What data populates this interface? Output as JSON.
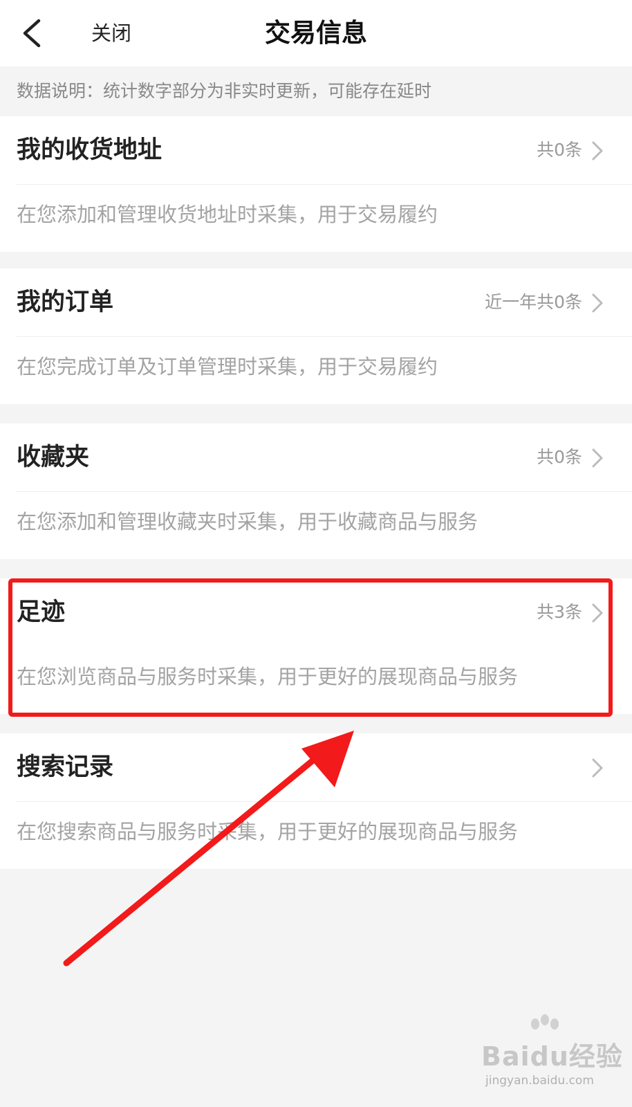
{
  "header": {
    "back_icon": "chevron-left-icon",
    "close_label": "关闭",
    "title": "交易信息"
  },
  "notice": {
    "text": "数据说明：统计数字部分为非实时更新，可能存在延时"
  },
  "sections": [
    {
      "title": "我的收货地址",
      "count": "共0条",
      "desc": "在您添加和管理收货地址时采集，用于交易履约"
    },
    {
      "title": "我的订单",
      "count": "近一年共0条",
      "desc": "在您完成订单及订单管理时采集，用于交易履约"
    },
    {
      "title": "收藏夹",
      "count": "共0条",
      "desc": "在您添加和管理收藏夹时采集，用于收藏商品与服务"
    },
    {
      "title": "足迹",
      "count": "共3条",
      "desc": "在您浏览商品与服务时采集，用于更好的展现商品与服务"
    },
    {
      "title": "搜索记录",
      "count": "",
      "desc": "在您搜索商品与服务时采集，用于更好的展现商品与服务"
    }
  ],
  "annotation": {
    "highlight_color": "#f21a1a",
    "highlighted_section": "足迹"
  },
  "watermark": {
    "brand": "Baidu经验",
    "sub": "jingyan.baidu.com"
  }
}
